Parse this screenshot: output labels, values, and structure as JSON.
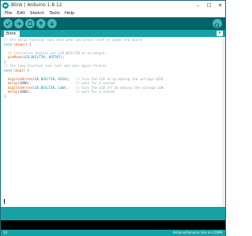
{
  "window": {
    "title": "Blink | Arduino 1.8.12",
    "controls": {
      "minimize": "–",
      "maximize": "☐",
      "close": "✕"
    }
  },
  "menubar": [
    "File",
    "Edit",
    "Sketch",
    "Tools",
    "Help"
  ],
  "toolbar": {
    "verify_icon": "check-icon",
    "upload_icon": "arrow-right-icon",
    "new_icon": "new-file-icon",
    "open_icon": "arrow-up-icon",
    "save_icon": "arrow-down-icon",
    "serial_monitor_icon": "magnifier-icon"
  },
  "tabs": [
    {
      "label": "Blink"
    }
  ],
  "tab_menu_glyph": "▾",
  "editor": {
    "lines": [
      "// the setup function runs once when you press reset or power the board",
      "void setup() {",
      "",
      "  // initialize digital pin LED_BUILTIN as an output.",
      "  pinMode(LED_BUILTIN, OUTPUT);",
      "}",
      "// the loop function runs over and over again forever",
      "void loop() {",
      "",
      "  digitalWrite(LED_BUILTIN, HIGH);   // turn the LED on by making the voltage HIGH",
      "  delay(1000);                       // wait for a second",
      "  digitalWrite(LED_BUILTIN, LOW);    // turn the LED off by making the voltage LOW",
      "  delay(1000);                       // wait for a second",
      "}"
    ]
  },
  "status": {
    "line_number": "14",
    "board": "Arduino/Genuino Uno on COM8"
  },
  "colors": {
    "toolbar": "#006468",
    "tabstrip": "#17a1a5",
    "button": "#4db7bb",
    "keyword": "#00979c",
    "function": "#d35400",
    "comment": "#95a5a6"
  }
}
